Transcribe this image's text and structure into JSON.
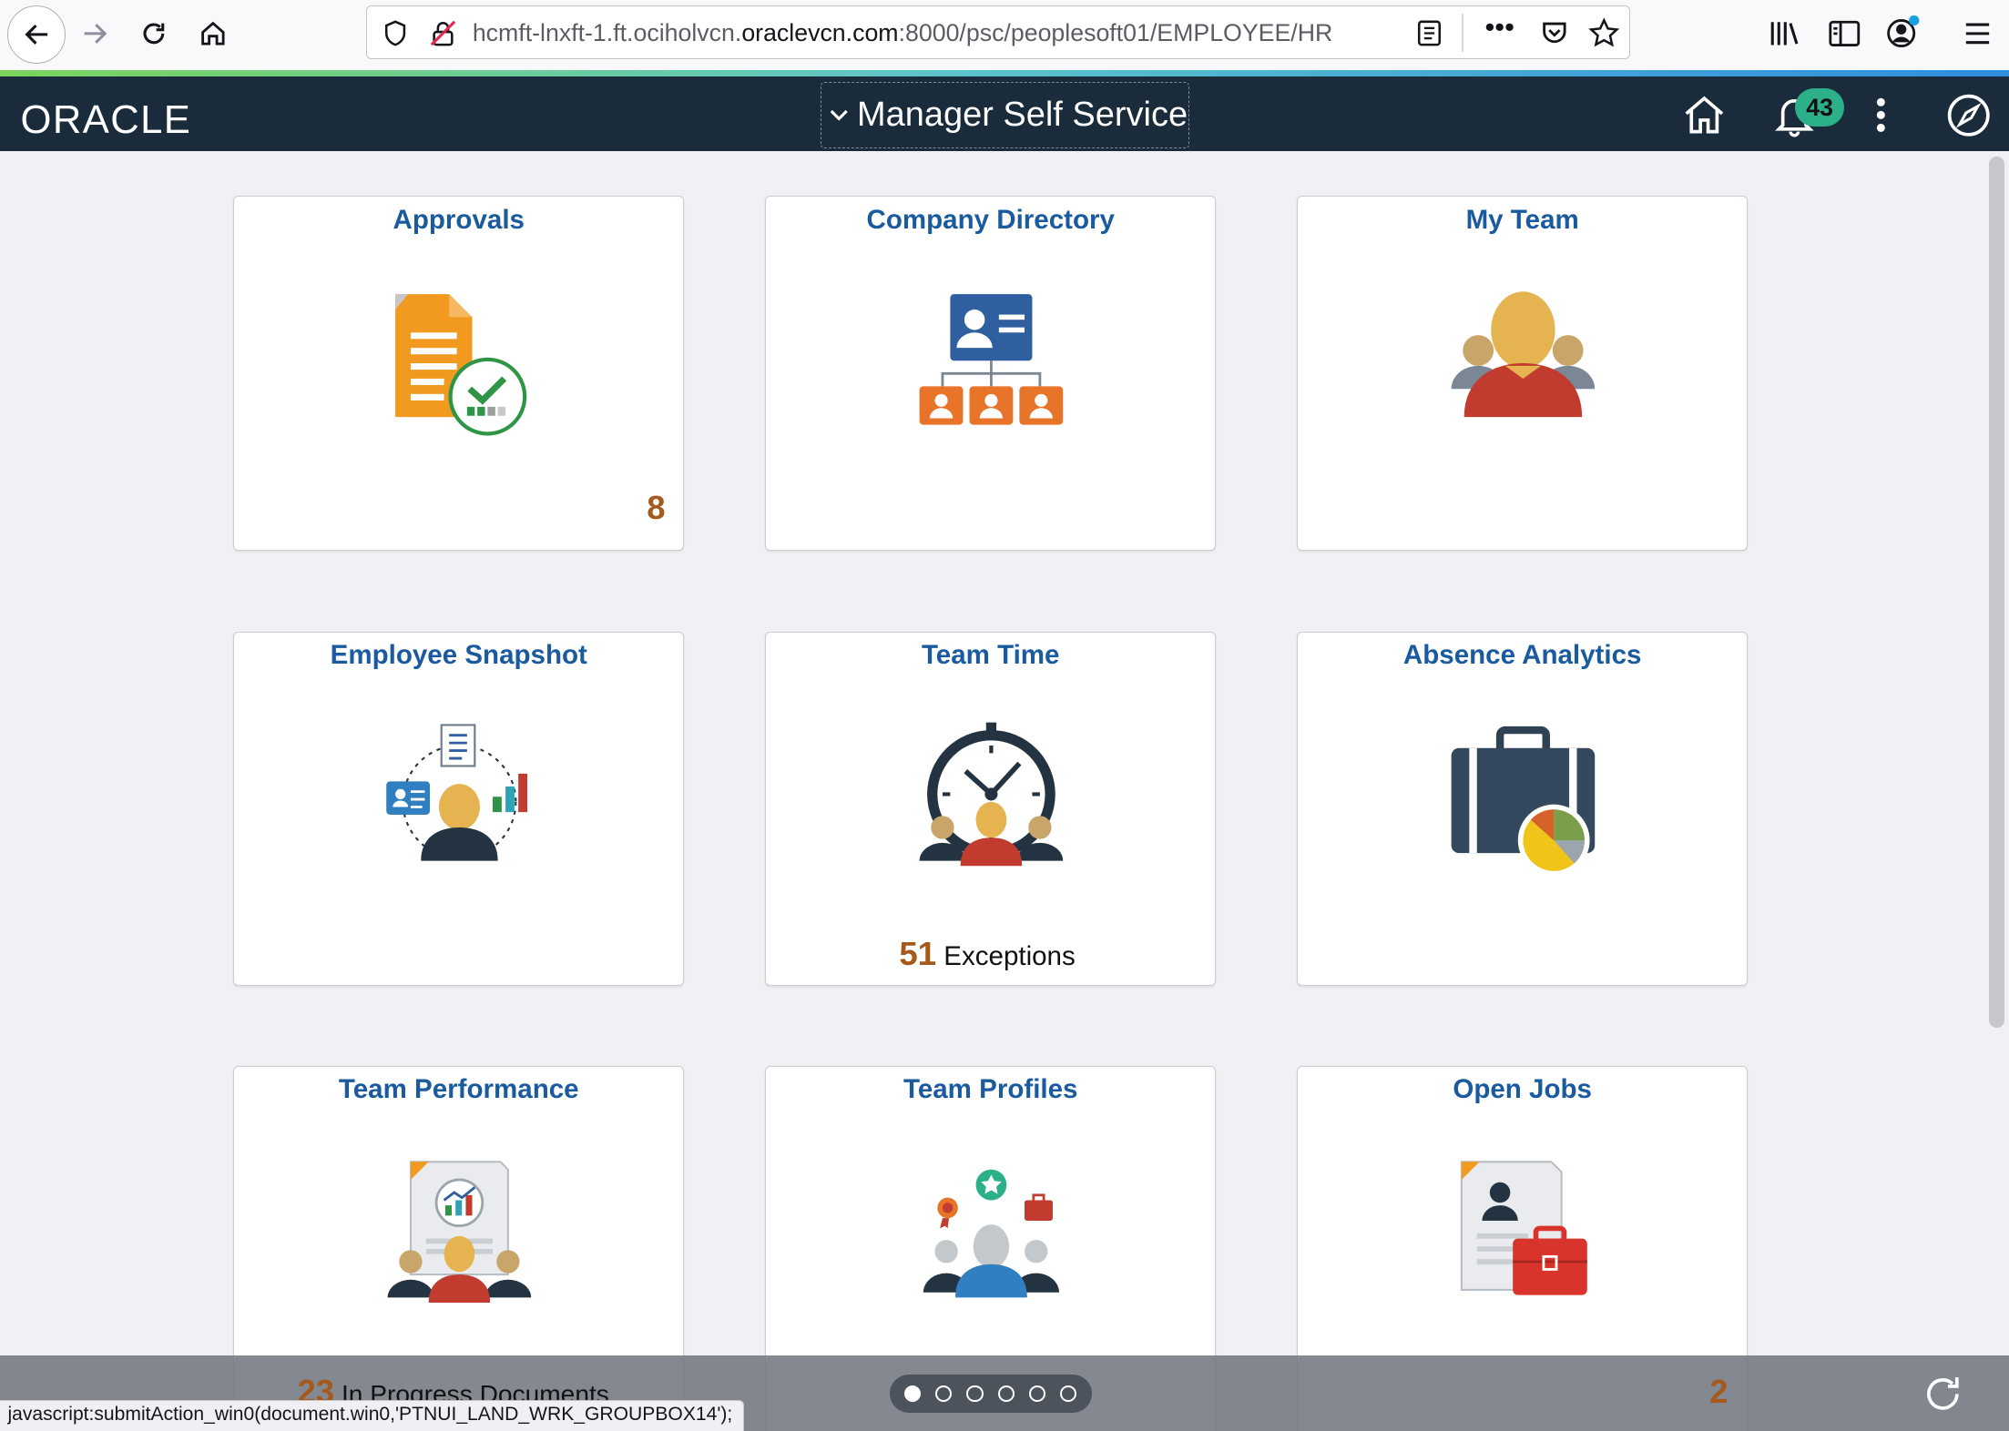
{
  "browser": {
    "url_host_prefix": "hcmft-lnxft-1.ft.ociholvcn.",
    "url_domain": "oraclevcn.com",
    "url_rest": ":8000/psc/peoplesoft01/EMPLOYEE/HR"
  },
  "header": {
    "logo": "ORACLE",
    "title": "Manager Self Service",
    "notification_count": "43"
  },
  "tiles": [
    {
      "title": "Approvals",
      "count": "8",
      "icon": "approvals-icon"
    },
    {
      "title": "Company Directory",
      "icon": "org-chart-icon"
    },
    {
      "title": "My Team",
      "icon": "team-icon"
    },
    {
      "title": "Employee Snapshot",
      "icon": "employee-snapshot-icon"
    },
    {
      "title": "Team Time",
      "count": "51",
      "count_label": "Exceptions",
      "icon": "clock-team-icon"
    },
    {
      "title": "Absence Analytics",
      "icon": "briefcase-chart-icon"
    },
    {
      "title": "Team Performance",
      "count": "23",
      "count_label": "In Progress Documents",
      "icon": "performance-icon"
    },
    {
      "title": "Team Profiles",
      "icon": "profiles-icon"
    },
    {
      "title": "Open Jobs",
      "count": "2",
      "icon": "job-posting-icon"
    }
  ],
  "pagination": {
    "pages": 6,
    "current": 1
  },
  "status_bar": "javascript:submitAction_win0(document.win0,'PTNUI_LAND_WRK_GROUPBOX14');",
  "colors": {
    "header_bg": "#1a2b3c",
    "tile_title": "#1a5a9e",
    "count": "#a35a1c",
    "badge": "#2cb08a"
  }
}
